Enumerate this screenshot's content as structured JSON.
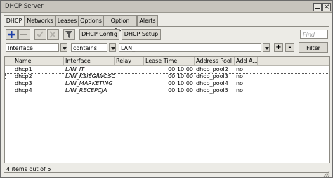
{
  "window": {
    "title": "DHCP Server"
  },
  "tabs": [
    {
      "label": "DHCP"
    },
    {
      "label": "Networks"
    },
    {
      "label": "Leases"
    },
    {
      "label": "Options"
    },
    {
      "label": "Option Sets"
    },
    {
      "label": "Alerts"
    }
  ],
  "toolbar": {
    "dhcp_config_label": "DHCP Config",
    "dhcp_setup_label": "DHCP Setup",
    "find_placeholder": "Find"
  },
  "filter": {
    "field": "Interface",
    "operator": "contains",
    "value": "LAN_",
    "add_label": "+",
    "remove_label": "-",
    "button_label": "Filter"
  },
  "table": {
    "headers": [
      "Name",
      "Interface",
      "Relay",
      "Lease Time",
      "Address Pool",
      "Add A..."
    ],
    "rows": [
      {
        "name": "dhcp1",
        "interface": "LAN_IT",
        "relay": "",
        "lease_time": "00:10:00",
        "address_pool": "dhcp_pool2",
        "add_arp": "no"
      },
      {
        "name": "dhcp2",
        "interface": "LAN_KSIEGIWOSC",
        "relay": "",
        "lease_time": "00:10:00",
        "address_pool": "dhcp_pool3",
        "add_arp": "no"
      },
      {
        "name": "dhcp3",
        "interface": "LAN_MARKETING",
        "relay": "",
        "lease_time": "00:10:00",
        "address_pool": "dhcp_pool4",
        "add_arp": "no"
      },
      {
        "name": "dhcp4",
        "interface": "LAN_RECEPCJA",
        "relay": "",
        "lease_time": "00:10:00",
        "address_pool": "dhcp_pool5",
        "add_arp": "no"
      }
    ]
  },
  "status": {
    "text": "4 items out of 5"
  },
  "colors": {
    "add_icon": "#1d3fa8",
    "window_bg": "#ecebe6"
  }
}
